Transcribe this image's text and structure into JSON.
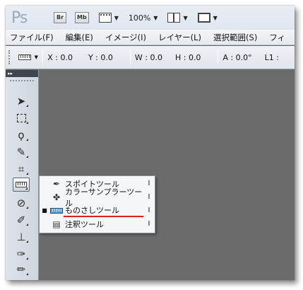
{
  "app": {
    "logo": "Ps",
    "bridge_label": "Br",
    "minibridge_label": "Mb",
    "zoom": "100%",
    "film_icon": "film-strip-icon",
    "arrange_icon": "arrange-documents-icon",
    "screen_icon": "screen-mode-icon"
  },
  "menu": {
    "items": [
      "ファイル(F)",
      "編集(E)",
      "イメージ(I)",
      "レイヤー(L)",
      "選択範囲(S)",
      "フィ"
    ]
  },
  "options": {
    "x": "X : 0.0",
    "y": "Y : 0.0",
    "w": "W : 0.0",
    "h": "H : 0.0",
    "a": "A : 0.0°",
    "l1": "L1 :"
  },
  "toolbox": {
    "header": "▸▸",
    "tools": [
      "move-tool",
      "marquee-tool",
      "lasso-tool",
      "quick-selection-tool",
      "crop-tool",
      "ruler-tool",
      "spot-healing-tool",
      "brush-tool",
      "stamp-tool",
      "history-brush-tool",
      "eraser-tool"
    ]
  },
  "flyout": {
    "items": [
      {
        "label": "スポイトツール",
        "shortcut": "I",
        "icon": "eyedropper-icon",
        "selected": false
      },
      {
        "label": "カラーサンプラーツール",
        "shortcut": "I",
        "icon": "color-sampler-icon",
        "selected": false
      },
      {
        "label": "ものさしツール",
        "shortcut": "I",
        "icon": "ruler-icon",
        "selected": true
      },
      {
        "label": "注釈ツール",
        "shortcut": "I",
        "icon": "note-icon",
        "selected": false
      }
    ],
    "bullet": "■"
  },
  "colors": {
    "canvas": "#6b6b6b",
    "highlight_underline": "#e02020"
  }
}
